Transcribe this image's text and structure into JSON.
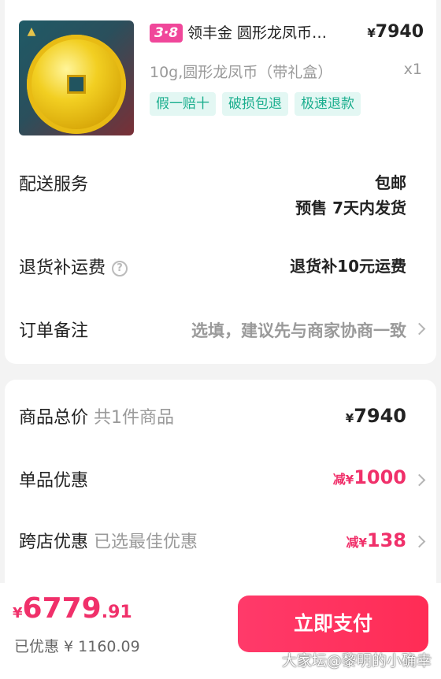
{
  "product": {
    "badge": "3·8",
    "title": "领丰金 圆形龙凤币…",
    "price_currency": "¥",
    "price": "7940",
    "spec": "10g,圆形龙凤币（带礼盒）",
    "qty": "x1",
    "tags": [
      "假一赔十",
      "破损包退",
      "极速退款"
    ]
  },
  "delivery": {
    "label": "配送服务",
    "line1": "包邮",
    "line2": "预售 7天内发货"
  },
  "return_shipping": {
    "label": "退货补运费",
    "help": "?",
    "value": "退货补10元运费"
  },
  "remark": {
    "label": "订单备注",
    "placeholder": "选填，建议先与商家协商一致"
  },
  "price_summary": {
    "total_label": "商品总价",
    "total_sub": "共1件商品",
    "total_currency": "¥",
    "total_value": "7940",
    "item_discount_label": "单品优惠",
    "item_discount_prefix": "减",
    "item_discount_currency": "¥",
    "item_discount_value": "1000",
    "cross_store_label": "跨店优惠",
    "cross_store_sub": "已选最佳优惠",
    "cross_store_prefix": "减",
    "cross_store_currency": "¥",
    "cross_store_value": "138"
  },
  "bottom": {
    "currency": "¥",
    "total_int": "6779",
    "total_dec": ".91",
    "saved": "已优惠 ¥ 1160.09",
    "pay_button": "立即支付",
    "watermark": "大家坛@黎明的小确幸"
  },
  "colors": {
    "accent": "#f0306a",
    "tag_bg": "#e3f7f3",
    "tag_text": "#1bae8e",
    "badge": "#f0479a"
  }
}
